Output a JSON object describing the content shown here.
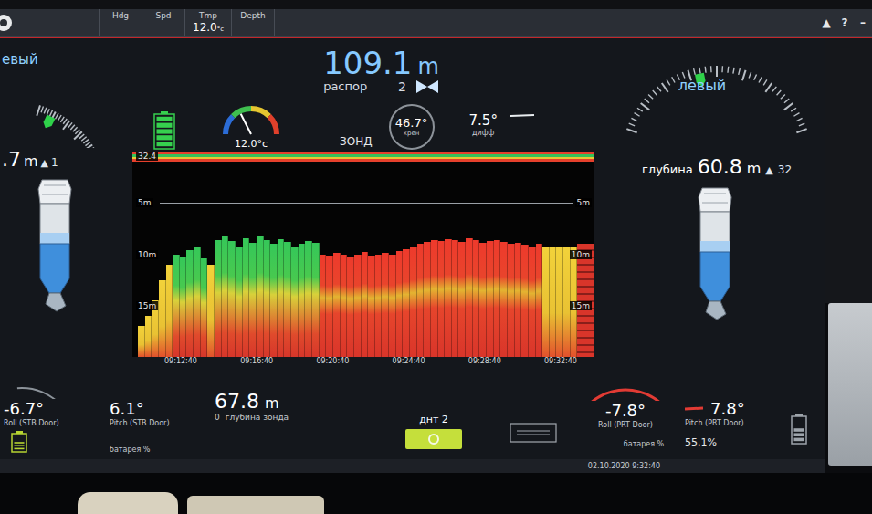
{
  "top_bar": {
    "items": [
      {
        "label": "Hdg"
      },
      {
        "label": "Spd"
      },
      {
        "label": "Tmp",
        "value": "12.0",
        "unit": "°c"
      },
      {
        "label": "Depth"
      }
    ],
    "icons": [
      "▲",
      "?",
      "–"
    ]
  },
  "spread": {
    "value": "109.1",
    "unit": "m",
    "label": "распор",
    "sensor": "2"
  },
  "left_door": {
    "title": "евый",
    "depth": ".7",
    "depth_unit": "m",
    "alarm": "▲",
    "alarm_count": "1",
    "marker_level": 0.15,
    "roll": "-6.7°",
    "roll_label": "Roll (STB Door)",
    "pitch": "6.1°",
    "pitch_label": "Pitch (STB Door)",
    "battery_label": "батарея %",
    "battery_level": 0.6
  },
  "right_door": {
    "title": "левый",
    "depth_label": "глубина",
    "depth": "60.8",
    "depth_unit": "m",
    "alarm": "▲",
    "alarm_count": "32",
    "marker_level": 0.42,
    "roll": "-7.8°",
    "roll_label": "Roll (PRT Door)",
    "pitch": "7.8°",
    "pitch_label": "Pitch (PRT Door)",
    "battery_label": "батарея %",
    "battery": "55.1%",
    "battery_level": 0.55
  },
  "sonde": {
    "battery_level": 1,
    "temperature": "12.0°c",
    "temperature_level": 0.35,
    "label": "ЗОНД",
    "roll": "46.7°",
    "roll_label": "крен",
    "trim": "7.5°",
    "trim_label": "дифф",
    "depth": "67.8",
    "depth_unit": "m",
    "depth_zero": "0",
    "depth_label": "глубина зонда"
  },
  "echogram": {
    "depth_range": 20,
    "y_ticks_left": [
      {
        "label": "32.4",
        "depth": 0
      },
      {
        "label": "5m",
        "depth": 5
      },
      {
        "label": "10m",
        "depth": 10
      },
      {
        "label": "15m",
        "depth": 15
      }
    ],
    "y_ticks_right": [
      {
        "label": "5m",
        "depth": 5
      },
      {
        "label": "10m",
        "depth": 10
      },
      {
        "label": "15m",
        "depth": 15
      }
    ],
    "x_ticks": [
      "09:12:40",
      "09:16:40",
      "09:20:40",
      "09:24:40",
      "09:28:40",
      "09:32:40"
    ],
    "columns": [
      {
        "top": 17,
        "level": 0.6
      },
      {
        "top": 16,
        "level": 0.6
      },
      {
        "top": 14.5,
        "level": 0.6
      },
      {
        "top": 12.5,
        "level": 0.55
      },
      {
        "top": 11,
        "level": 0.5
      },
      {
        "top": 10,
        "level": 0.4
      },
      {
        "top": 10.3,
        "level": 0.35
      },
      {
        "top": 9.6,
        "level": 0.35
      },
      {
        "top": 9.2,
        "level": 0.3
      },
      {
        "top": 10.4,
        "level": 0.4
      },
      {
        "top": 11,
        "level": 0.45
      },
      {
        "top": 8.6,
        "level": 0.3
      },
      {
        "top": 8.3,
        "level": 0.3
      },
      {
        "top": 8.7,
        "level": 0.35
      },
      {
        "top": 9.3,
        "level": 0.3
      },
      {
        "top": 8.4,
        "level": 0.3
      },
      {
        "top": 8.9,
        "level": 0.35
      },
      {
        "top": 8.3,
        "level": 0.3
      },
      {
        "top": 8.6,
        "level": 0.3
      },
      {
        "top": 9.0,
        "level": 0.35
      },
      {
        "top": 8.5,
        "level": 0.3
      },
      {
        "top": 8.8,
        "level": 0.35
      },
      {
        "top": 9.3,
        "level": 0.4
      },
      {
        "top": 9.0,
        "level": 0.35
      },
      {
        "top": 8.7,
        "level": 0.3
      },
      {
        "top": 8.9,
        "level": 0.4
      },
      {
        "top": 10.0,
        "level": 0.8
      },
      {
        "top": 10.1,
        "level": 0.85
      },
      {
        "top": 9.9,
        "level": 0.85
      },
      {
        "top": 10.0,
        "level": 0.8
      },
      {
        "top": 10.2,
        "level": 0.85
      },
      {
        "top": 10.0,
        "level": 0.8
      },
      {
        "top": 9.8,
        "level": 0.85
      },
      {
        "top": 10.1,
        "level": 0.8
      },
      {
        "top": 10.0,
        "level": 0.85
      },
      {
        "top": 9.9,
        "level": 0.8
      },
      {
        "top": 10.0,
        "level": 0.8
      },
      {
        "top": 9.7,
        "level": 0.85
      },
      {
        "top": 9.5,
        "level": 0.8
      },
      {
        "top": 9.2,
        "level": 0.8
      },
      {
        "top": 9.0,
        "level": 0.85
      },
      {
        "top": 8.8,
        "level": 0.8
      },
      {
        "top": 8.6,
        "level": 0.75
      },
      {
        "top": 8.7,
        "level": 0.8
      },
      {
        "top": 8.5,
        "level": 0.75
      },
      {
        "top": 8.6,
        "level": 0.8
      },
      {
        "top": 8.8,
        "level": 0.75
      },
      {
        "top": 8.4,
        "level": 0.8
      },
      {
        "top": 8.6,
        "level": 0.75
      },
      {
        "top": 8.9,
        "level": 0.8
      },
      {
        "top": 8.7,
        "level": 0.75
      },
      {
        "top": 8.6,
        "level": 0.8
      },
      {
        "top": 8.8,
        "level": 0.75
      },
      {
        "top": 9.0,
        "level": 0.8
      },
      {
        "top": 8.9,
        "level": 0.8
      },
      {
        "top": 9.1,
        "level": 0.85
      },
      {
        "top": 9.3,
        "level": 0.8
      },
      {
        "top": 9.0,
        "level": 0.8
      },
      {
        "top": 9.2,
        "level": 0.55
      },
      {
        "top": 9.2,
        "level": 0.55
      },
      {
        "top": 9.2,
        "level": 0.55
      },
      {
        "top": 9.2,
        "level": 0.55
      },
      {
        "top": 9.2,
        "level": 0.55
      }
    ]
  },
  "button": {
    "label": "днт 2"
  },
  "status_bar": {
    "datetime": "02.10.2020 9:32:40"
  }
}
